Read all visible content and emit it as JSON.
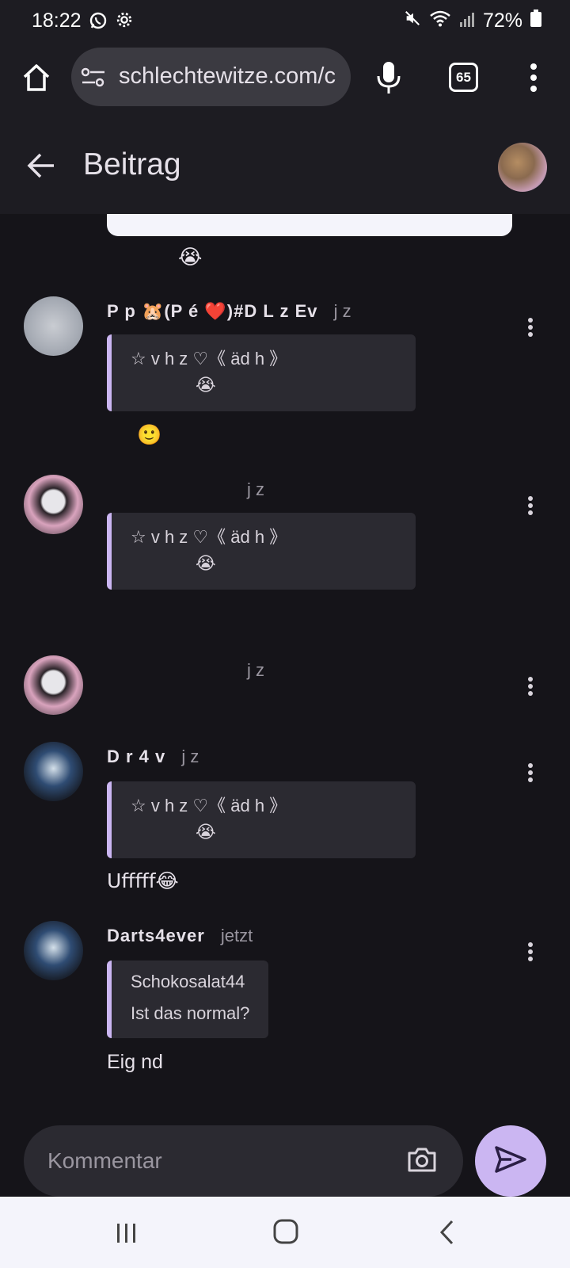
{
  "status_bar": {
    "time": "18:22",
    "battery": "72%",
    "icons": [
      "whatsapp-icon",
      "settings-icon",
      "mute-icon",
      "wifi-icon",
      "signal-icon",
      "battery-icon"
    ]
  },
  "browser": {
    "url": "schlechtewitze.com/c",
    "tab_count": "65"
  },
  "header": {
    "title": "Beitrag"
  },
  "comments": [
    {
      "author": "P p 🐹(P  é     ❤️)#D  L  z  Ev",
      "time": "j  z",
      "quote_text": "☆   v     h   z  ♡《  äd  h   》",
      "quote_emoji": "😭",
      "body": "🙂"
    },
    {
      "author": "",
      "time": "j  z",
      "quote_text": "☆   v     h   z  ♡《  äd  h   》",
      "quote_emoji": "😭",
      "body": ""
    },
    {
      "author": "",
      "time": "j  z",
      "body": ""
    },
    {
      "author": "D r  4 v",
      "time": "j  z",
      "quote_text": "☆   v     h   z  ♡《  äd  h   》",
      "quote_emoji": "😭",
      "body": "Ufffff😂"
    },
    {
      "author": "Darts4ever",
      "time": "jetzt",
      "quote_author": "Schokosalat44",
      "quote_text": "Ist das normal?",
      "body": "Eig nd"
    }
  ],
  "top_emoji": "😭",
  "composer": {
    "placeholder": "Kommentar"
  },
  "colors": {
    "background": "#151419",
    "surface": "#1d1c22",
    "accent": "#cbb6f2",
    "quote_bg": "#2b2a31"
  }
}
